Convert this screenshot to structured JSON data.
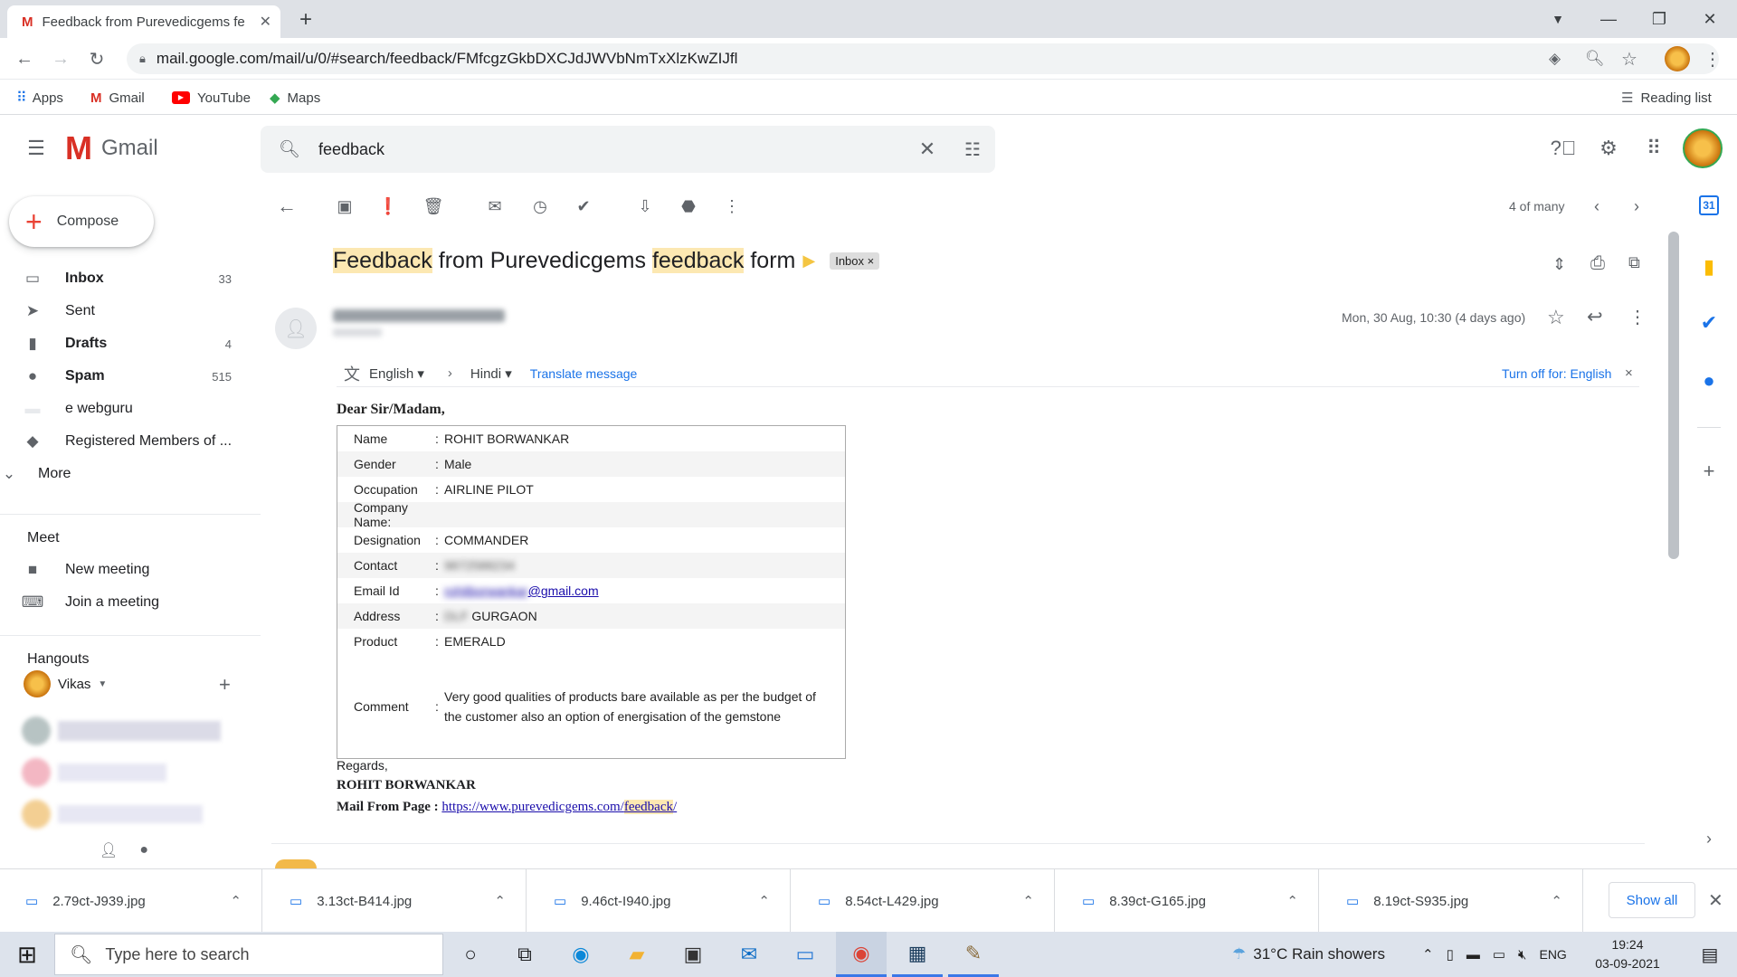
{
  "browser": {
    "tab_title": "Feedback from Purevedicgems fe",
    "url": "mail.google.com/mail/u/0/#search/feedback/FMfcgzGkbDXCJdJWVbNmTxXlzKwZIJfl",
    "bookmarks": [
      "Apps",
      "Gmail",
      "YouTube",
      "Maps"
    ],
    "reading_list": "Reading list"
  },
  "gmail": {
    "logo_text": "Gmail",
    "search_value": "feedback",
    "compose_label": "Compose",
    "nav": [
      {
        "label": "Inbox",
        "count": "33"
      },
      {
        "label": "Sent",
        "count": ""
      },
      {
        "label": "Drafts",
        "count": "4"
      },
      {
        "label": "Spam",
        "count": "515"
      },
      {
        "label": "e webguru",
        "count": ""
      },
      {
        "label": "Registered Members of ...",
        "count": ""
      },
      {
        "label": "More",
        "count": ""
      }
    ],
    "meet_heading": "Meet",
    "meet_items": [
      "New meeting",
      "Join a meeting"
    ],
    "hangouts_heading": "Hangouts",
    "hangouts_user": "Vikas",
    "pagination": "4 of many"
  },
  "message": {
    "subject_parts": [
      "Feedback",
      " from Purevedicgems ",
      "feedback",
      " form"
    ],
    "label": "Inbox",
    "date": "Mon, 30 Aug, 10:30 (4 days ago)",
    "translate": {
      "from_lang": "English",
      "to_lang": "Hindi",
      "translate_link": "Translate message",
      "turn_off": "Turn off for: English"
    },
    "greeting": "Dear Sir/Madam,",
    "fields": [
      {
        "key": "Name",
        "colon": ":",
        "value": "ROHIT BORWANKAR"
      },
      {
        "key": "Gender",
        "colon": ":",
        "value": "Male"
      },
      {
        "key": "Occupation",
        "colon": ":",
        "value": "AIRLINE PILOT"
      },
      {
        "key": "Company Name:",
        "colon": "",
        "value": ""
      },
      {
        "key": "Designation",
        "colon": ":",
        "value": "COMMANDER"
      },
      {
        "key": "Contact",
        "colon": ":",
        "value": "9872588234"
      },
      {
        "key": "Email Id",
        "colon": ":",
        "value": "gmail.com"
      },
      {
        "key": "Address",
        "colon": ":",
        "value": "GURGAON"
      },
      {
        "key": "Product",
        "colon": ":",
        "value": "EMERALD"
      }
    ],
    "comment_key": "Comment",
    "comment_value": "Very good qualities of products bare available as per the budget of the customer also an option of energisation of the gemstone",
    "regards": "Regards,",
    "signature": "ROHIT BORWANKAR",
    "mail_from_label": "Mail From Page :",
    "mail_from_url_prefix": "https://www.purevedicgems.com/",
    "mail_from_url_hl": "feedback",
    "mail_from_url_suffix": "/"
  },
  "downloads": {
    "files": [
      "2.79ct-J939.jpg",
      "3.13ct-B414.jpg",
      "9.46ct-I940.jpg",
      "8.54ct-L429.jpg",
      "8.39ct-G165.jpg",
      "8.19ct-S935.jpg"
    ],
    "show_all": "Show all"
  },
  "taskbar": {
    "search_placeholder": "Type here to search",
    "weather": "31°C  Rain showers",
    "lang": "ENG",
    "time": "19:24",
    "date": "03-09-2021"
  },
  "colors": {
    "highlight": "#fce8b2",
    "link": "#1a0dab",
    "translate_link": "#1a73e8"
  }
}
